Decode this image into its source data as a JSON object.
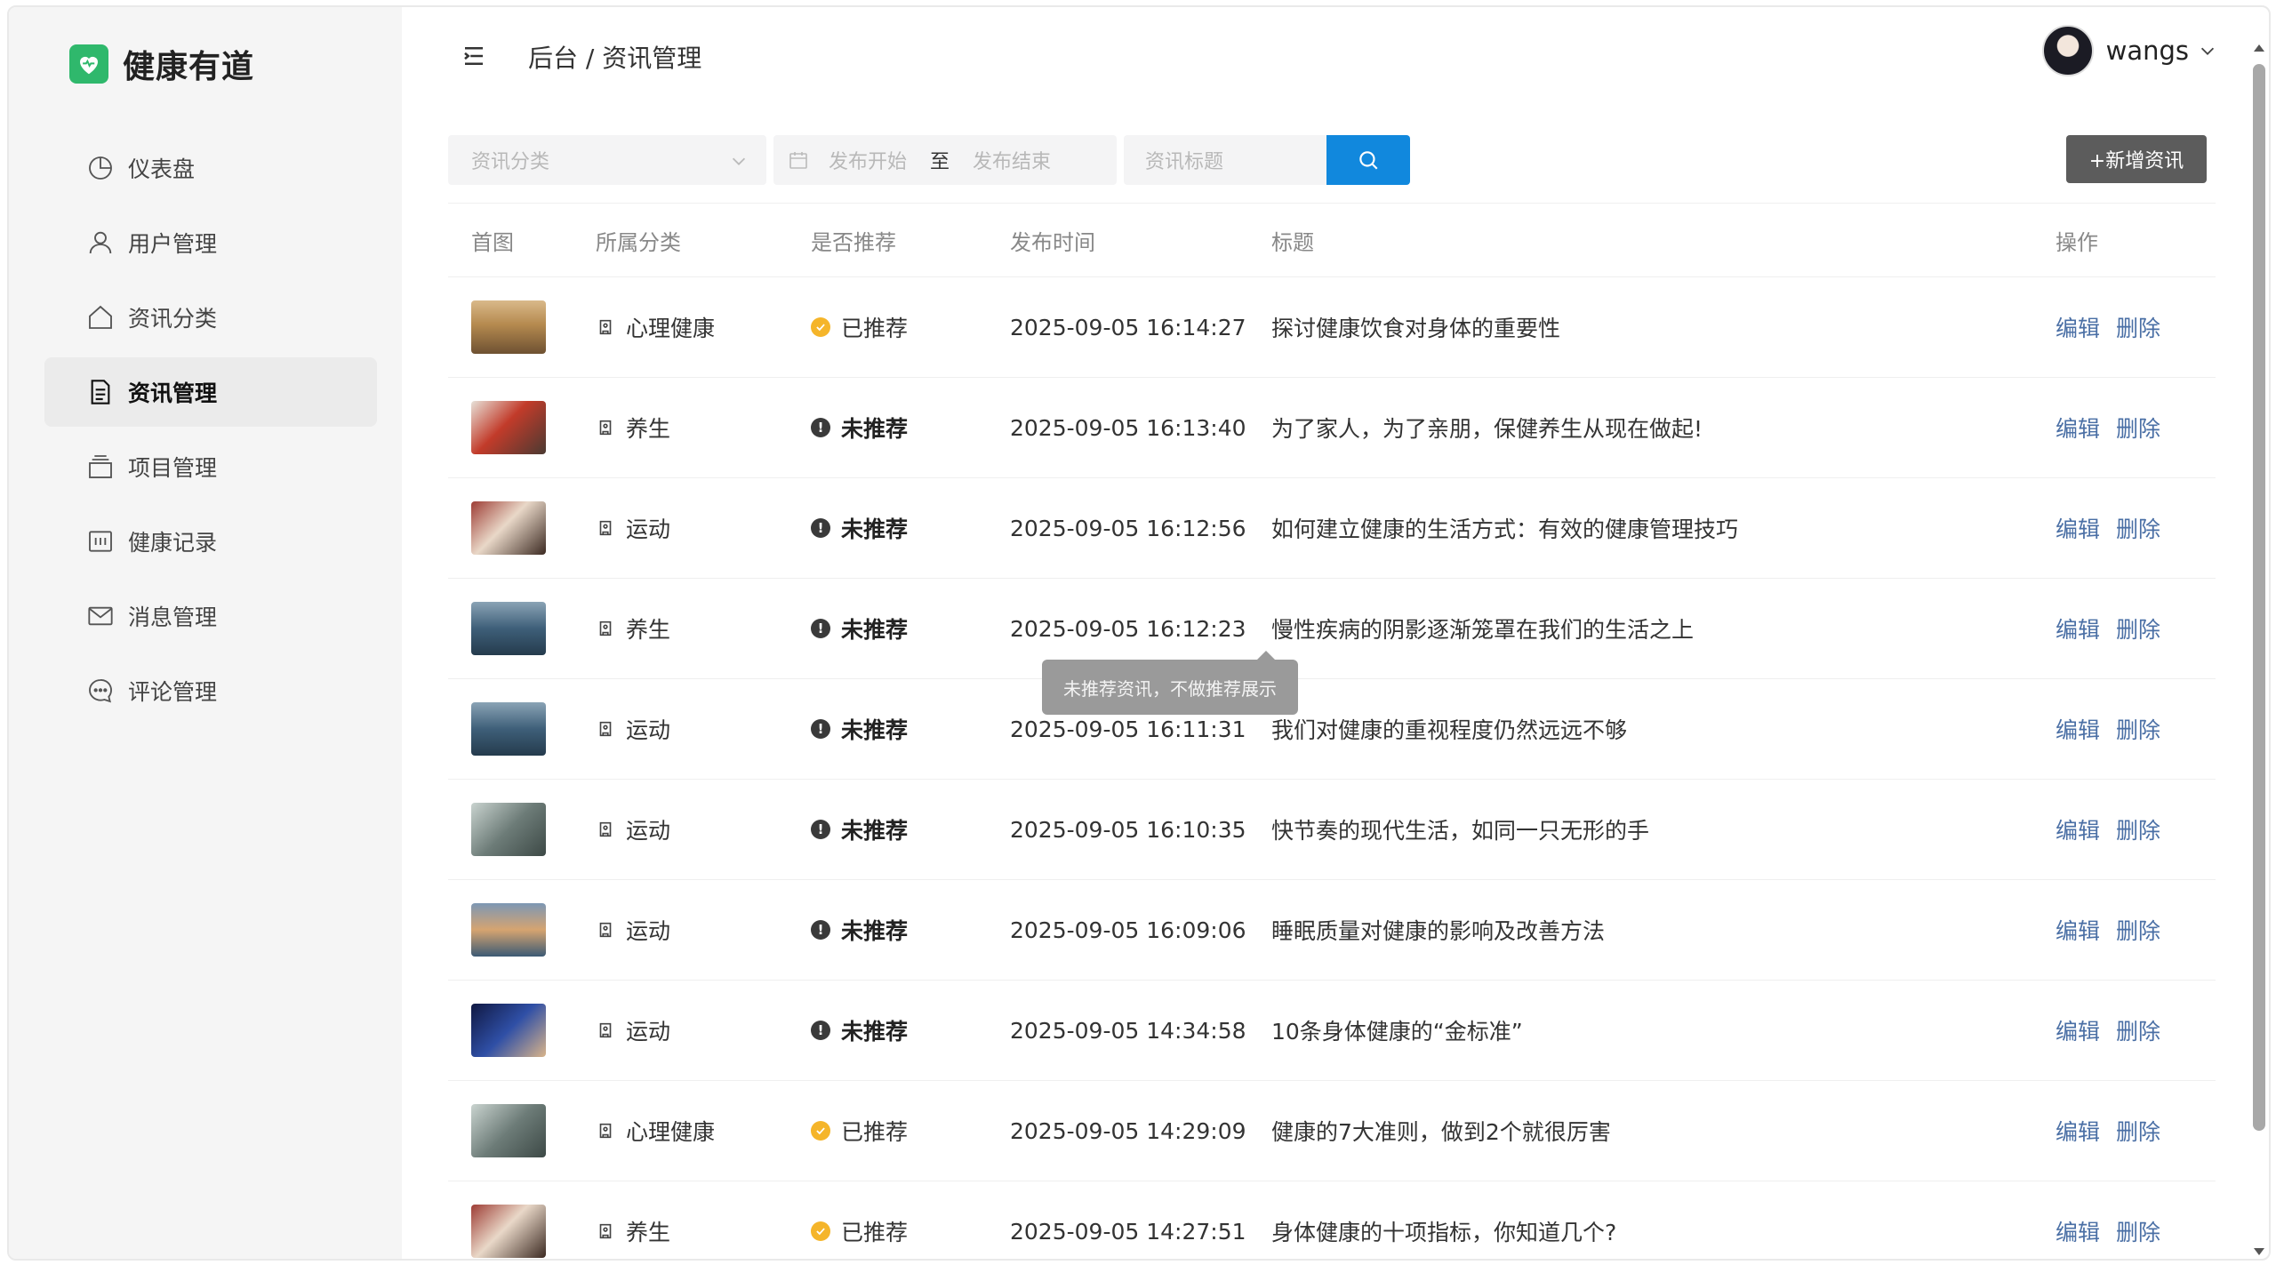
{
  "app": {
    "title": "健康有道",
    "brand_color": "#2fb86c"
  },
  "sidebar": {
    "items": [
      {
        "label": "仪表盘",
        "icon": "pie-chart-icon"
      },
      {
        "label": "用户管理",
        "icon": "user-icon"
      },
      {
        "label": "资讯分类",
        "icon": "home-icon"
      },
      {
        "label": "资讯管理",
        "icon": "document-icon",
        "active": true
      },
      {
        "label": "项目管理",
        "icon": "stack-icon"
      },
      {
        "label": "健康记录",
        "icon": "record-icon"
      },
      {
        "label": "消息管理",
        "icon": "mail-icon"
      },
      {
        "label": "评论管理",
        "icon": "comment-icon"
      }
    ]
  },
  "header": {
    "breadcrumb": "后台 / 资讯管理",
    "username": "wangs"
  },
  "toolbar": {
    "category_placeholder": "资讯分类",
    "date_start_placeholder": "发布开始",
    "date_separator": "至",
    "date_end_placeholder": "发布结束",
    "title_placeholder": "资讯标题",
    "add_label": "+新增资讯",
    "search_color": "#1188dd"
  },
  "table": {
    "headers": {
      "image": "首图",
      "category": "所属分类",
      "recommended": "是否推荐",
      "time": "发布时间",
      "title": "标题",
      "ops": "操作"
    },
    "edit_label": "编辑",
    "delete_label": "删除",
    "rows": [
      {
        "category": "心理健康",
        "recommended": "已推荐",
        "is_recommended": true,
        "time": "2025-09-05 16:14:27",
        "title": "探讨健康饮食对身体的重要性"
      },
      {
        "category": "养生",
        "recommended": "未推荐",
        "is_recommended": false,
        "time": "2025-09-05 16:13:40",
        "title": "为了家人，为了亲朋，保健养生从现在做起!"
      },
      {
        "category": "运动",
        "recommended": "未推荐",
        "is_recommended": false,
        "time": "2025-09-05 16:12:56",
        "title": "如何建立健康的生活方式：有效的健康管理技巧"
      },
      {
        "category": "养生",
        "recommended": "未推荐",
        "is_recommended": false,
        "time": "2025-09-05 16:12:23",
        "title": "慢性疾病的阴影逐渐笼罩在我们的生活之上"
      },
      {
        "category": "运动",
        "recommended": "未推荐",
        "is_recommended": false,
        "time": "2025-09-05 16:11:31",
        "title": "我们对健康的重视程度仍然远远不够"
      },
      {
        "category": "运动",
        "recommended": "未推荐",
        "is_recommended": false,
        "time": "2025-09-05 16:10:35",
        "title": "快节奏的现代生活，如同一只无形的手"
      },
      {
        "category": "运动",
        "recommended": "未推荐",
        "is_recommended": false,
        "time": "2025-09-05 16:09:06",
        "title": "睡眠质量对健康的影响及改善方法"
      },
      {
        "category": "运动",
        "recommended": "未推荐",
        "is_recommended": false,
        "time": "2025-09-05 14:34:58",
        "title": "10条身体健康的“金标准”"
      },
      {
        "category": "心理健康",
        "recommended": "已推荐",
        "is_recommended": true,
        "time": "2025-09-05 14:29:09",
        "title": "健康的7大准则，做到2个就很厉害"
      },
      {
        "category": "养生",
        "recommended": "已推荐",
        "is_recommended": true,
        "time": "2025-09-05 14:27:51",
        "title": "身体健康的十项指标，你知道几个?"
      }
    ]
  },
  "tooltip": {
    "text": "未推荐资讯，不做推荐展示"
  }
}
